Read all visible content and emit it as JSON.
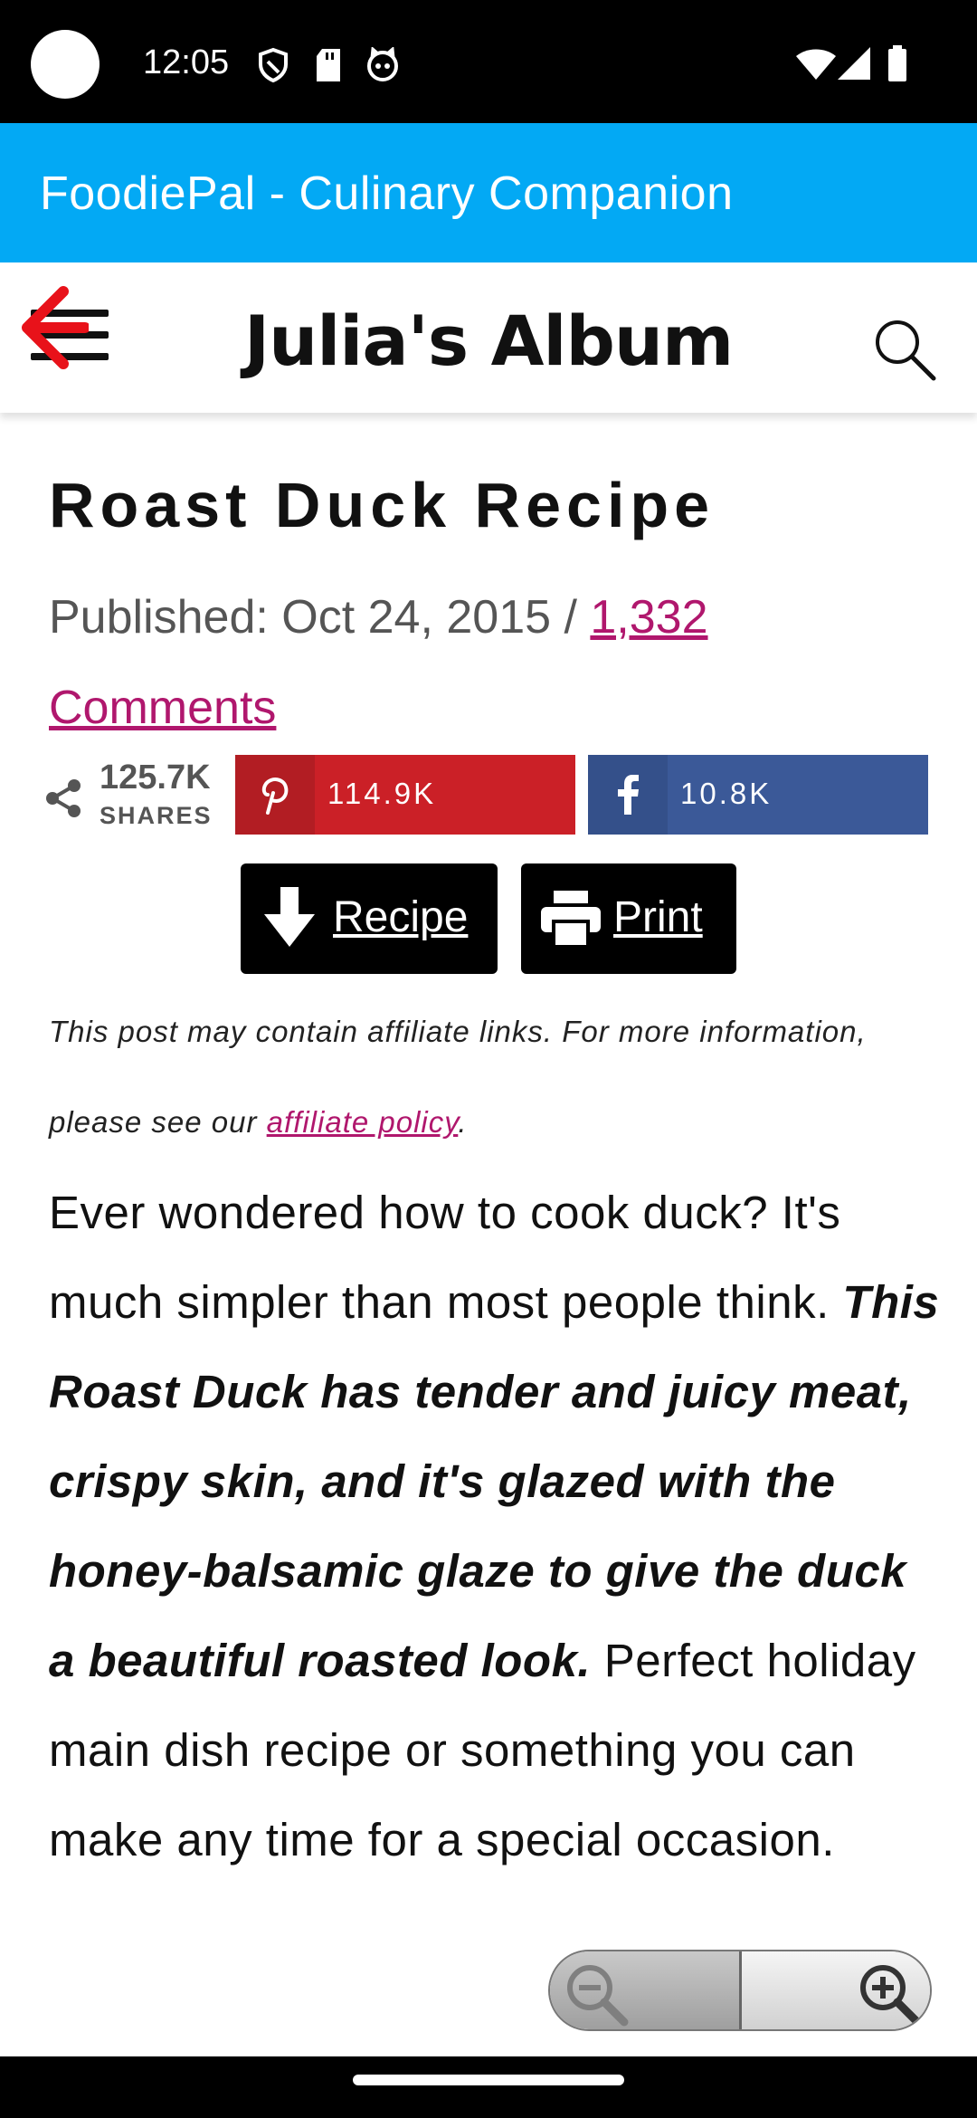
{
  "status_bar": {
    "time": "12:05",
    "left_icons": [
      "shield-icon",
      "sd-card-icon",
      "cat-face-icon"
    ],
    "right_icons": [
      "wifi-icon",
      "signal-icon",
      "battery-icon"
    ]
  },
  "app_bar": {
    "title": "FoodiePal - Culinary Companion",
    "color": "#03A9F4"
  },
  "site_header": {
    "title": "Julia's Album",
    "icons": [
      "hamburger-menu-icon",
      "back-arrow-icon",
      "search-icon"
    ]
  },
  "post": {
    "title": "Roast Duck Recipe",
    "published_prefix": "Published: Oct 24, 2015 / ",
    "comments_link": "1,332 Comments"
  },
  "share": {
    "total": "125.7K",
    "total_label": "SHARES",
    "pinterest_count": "114.9K",
    "facebook_count": "10.8K",
    "pinterest_color": "#CB2027",
    "facebook_color": "#3B5998"
  },
  "actions": {
    "recipe_label": "Recipe",
    "print_label": "Print"
  },
  "disclaimer": {
    "text": "This post may contain affiliate links. For more information, please see our ",
    "link": "affiliate policy",
    "end": "."
  },
  "body": {
    "intro": "Ever wondered how to cook duck? It's much simpler than most people think. ",
    "bold": "This Roast Duck has tender and juicy meat, crispy skin, and it's glazed with the honey-balsamic glaze to give the duck a beautiful roasted look.",
    "rest": "  Perfect holiday main dish recipe or something you can make any time for a special occasion."
  },
  "zoom_control": {
    "icons": [
      "zoom-out-icon",
      "zoom-in-icon"
    ]
  }
}
